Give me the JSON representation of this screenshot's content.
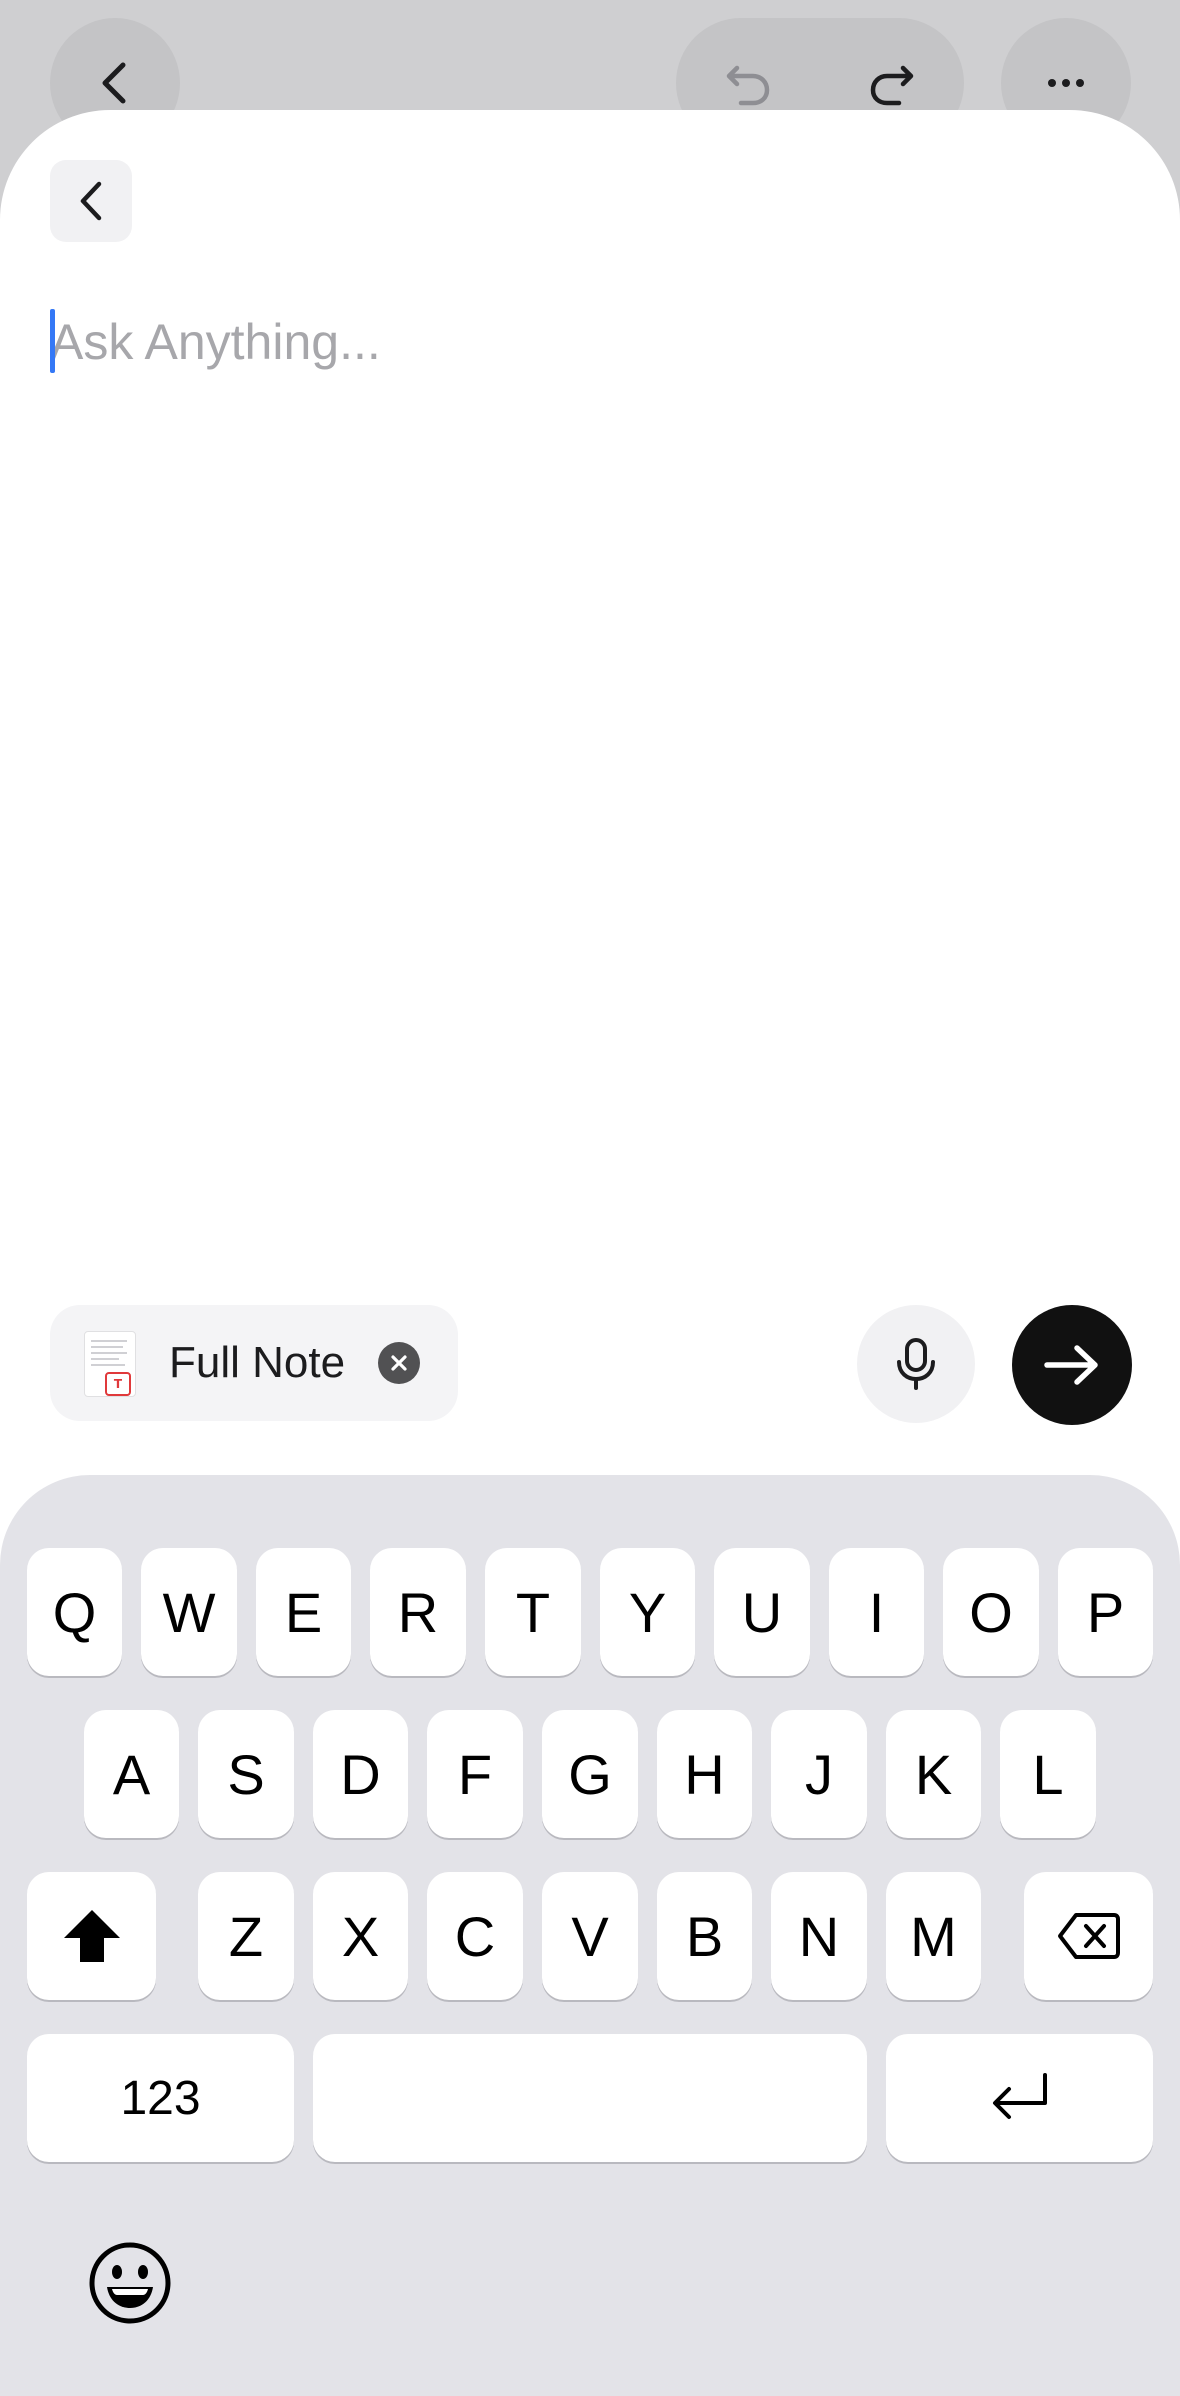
{
  "prompt": {
    "placeholder": "Ask Anything...",
    "value": ""
  },
  "context_chip": {
    "label": "Full Note"
  },
  "keyboard": {
    "row1": [
      "Q",
      "W",
      "E",
      "R",
      "T",
      "Y",
      "U",
      "I",
      "O",
      "P"
    ],
    "row2": [
      "A",
      "S",
      "D",
      "F",
      "G",
      "H",
      "J",
      "K",
      "L"
    ],
    "row3": [
      "Z",
      "X",
      "C",
      "V",
      "B",
      "N",
      "M"
    ],
    "numbers_label": "123"
  },
  "icons": {
    "background_back": "chevron-left-icon",
    "undo": "undo-icon",
    "redo": "redo-icon",
    "more": "more-horizontal-icon",
    "sheet_back": "chevron-left-icon",
    "document": "document-thumbnail-icon",
    "remove": "close-circle-icon",
    "mic": "microphone-icon",
    "send": "arrow-right-icon",
    "shift": "shift-icon",
    "backspace": "backspace-icon",
    "return": "return-icon",
    "emoji": "emoji-icon"
  },
  "colors": {
    "accent_caret": "#3478f6",
    "send_button": "#111111",
    "badge_red": "#e0393b"
  }
}
